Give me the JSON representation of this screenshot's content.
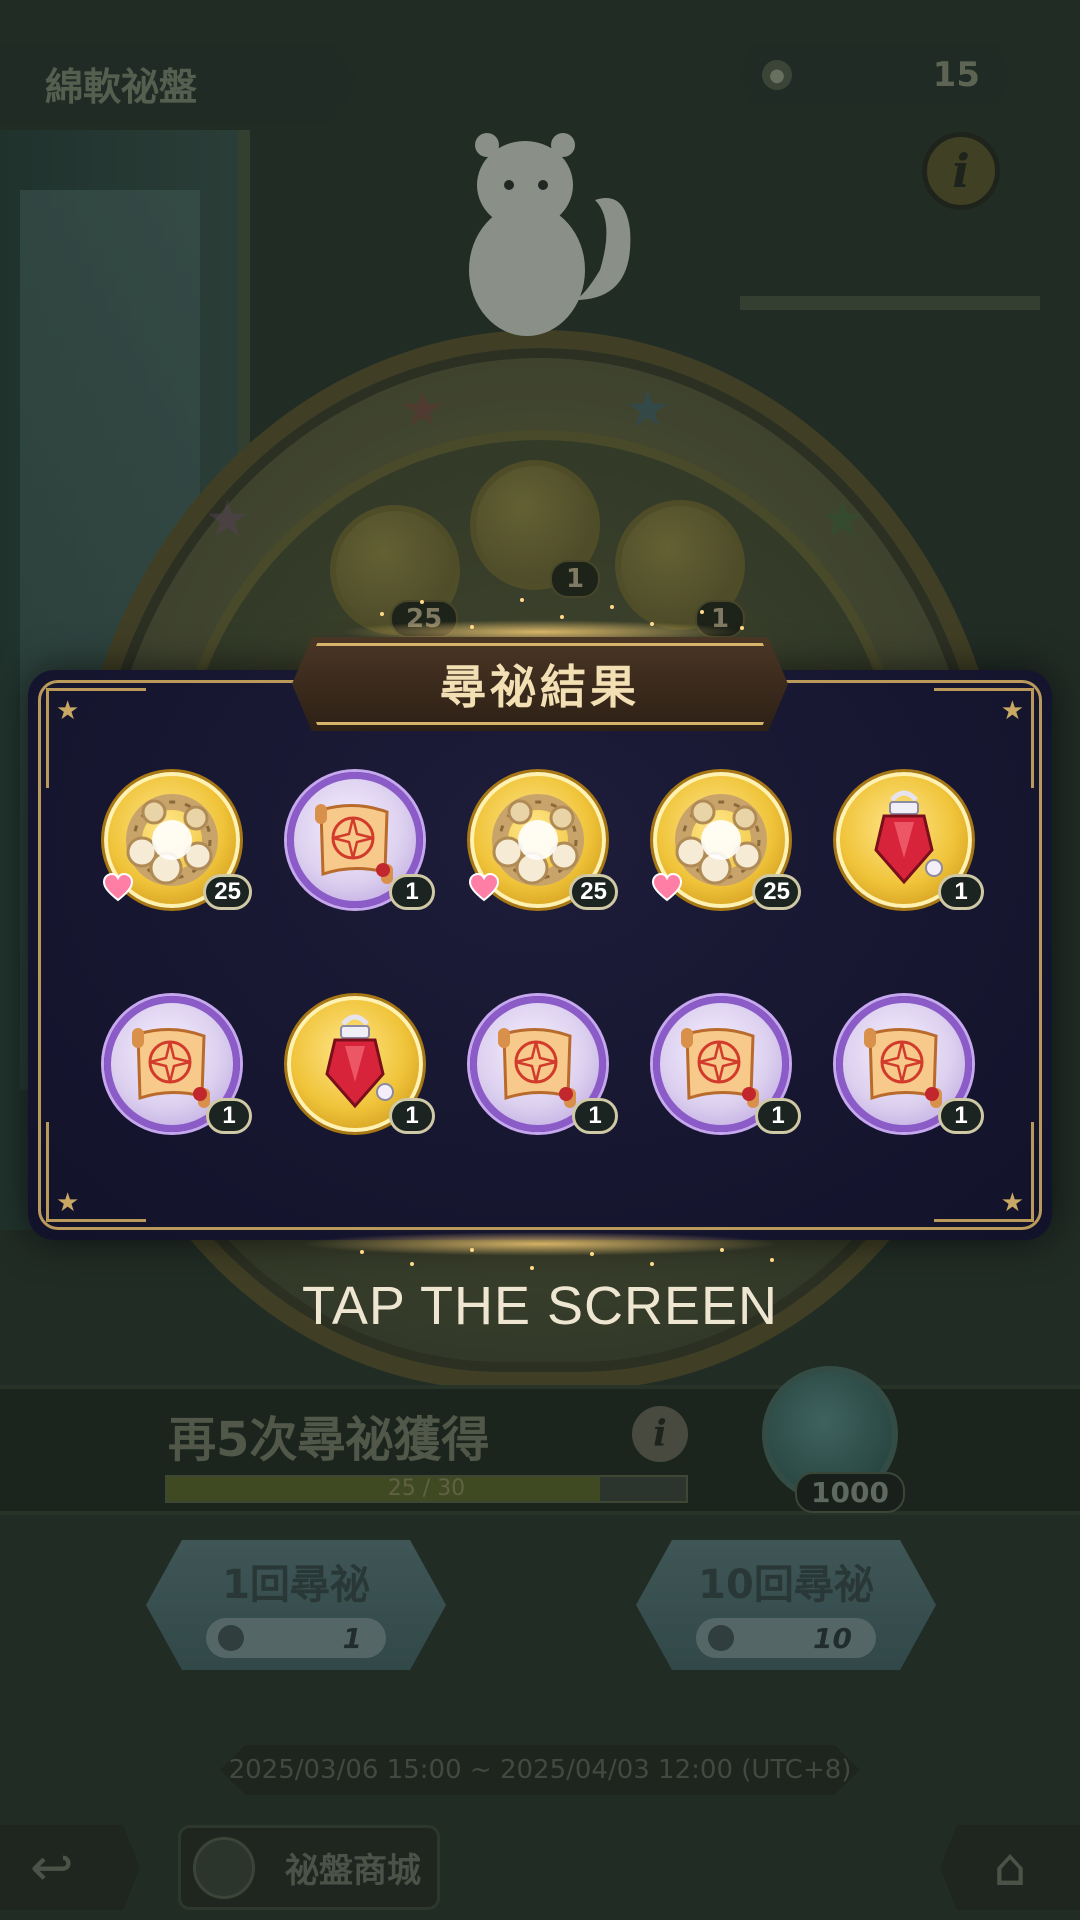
{
  "header": {
    "title": "綿軟祕盤",
    "currency_icon": "ticket-icon",
    "currency_value": "15",
    "info_icon": "i"
  },
  "wheel": {
    "visible_counts": [
      "1",
      "1",
      "25"
    ]
  },
  "modal": {
    "title": "尋祕結果",
    "items": [
      {
        "kind": "rose-wreath",
        "frame": "gold",
        "count": "25",
        "heart": true
      },
      {
        "kind": "scroll",
        "frame": "purple",
        "count": "1",
        "heart": false
      },
      {
        "kind": "rose-wreath",
        "frame": "gold",
        "count": "25",
        "heart": true
      },
      {
        "kind": "rose-wreath",
        "frame": "gold",
        "count": "25",
        "heart": true
      },
      {
        "kind": "red-crystal-lamp",
        "frame": "gold",
        "count": "1",
        "heart": false
      },
      {
        "kind": "scroll",
        "frame": "purple",
        "count": "1",
        "heart": false
      },
      {
        "kind": "red-crystal-lamp",
        "frame": "gold",
        "count": "1",
        "heart": false
      },
      {
        "kind": "scroll",
        "frame": "purple",
        "count": "1",
        "heart": false
      },
      {
        "kind": "scroll",
        "frame": "purple",
        "count": "1",
        "heart": false
      },
      {
        "kind": "scroll",
        "frame": "purple",
        "count": "1",
        "heart": false
      }
    ]
  },
  "tap_prompt": "TAP THE SCREEN",
  "progress": {
    "label": "再5次尋祕獲得",
    "current": 25,
    "max": 30,
    "count_text": "25 / 30",
    "reward_count": "1000",
    "info_icon": "i"
  },
  "pull_buttons": {
    "single": {
      "label": "1回尋祕",
      "cost": "1"
    },
    "ten": {
      "label": "10回尋祕",
      "cost": "10"
    }
  },
  "event_period": "2025/03/06 15:00 ~ 2025/04/03 12:00 (UTC+8)",
  "nav": {
    "back_icon": "↩",
    "shop_label": "祕盤商城",
    "home_icon": "⌂"
  },
  "colors": {
    "gold_frame": "#f0c43a",
    "purple_frame": "#8b5cc7",
    "modal_bg": "#161630",
    "accent_gold": "#b99a5a"
  }
}
